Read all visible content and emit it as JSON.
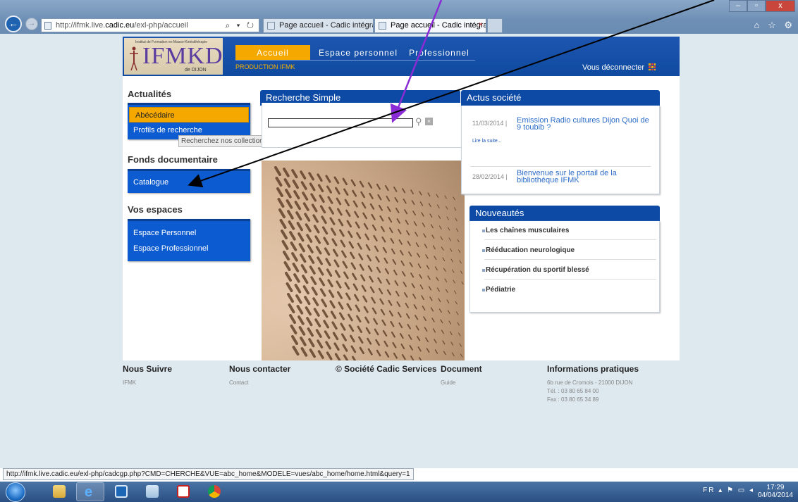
{
  "browser": {
    "url_prefix": "http://ifmk.live.",
    "url_domain": "cadic.eu",
    "url_suffix": "/exl-php/accueil",
    "address_tools": "⌕ ▾ ↻",
    "tabs": [
      {
        "label": "Page accueil - Cadic intégrale"
      },
      {
        "label": "Page accueil - Cadic intégrale",
        "close": "×"
      }
    ],
    "window_controls": {
      "minimize": "–",
      "maximize": "▫",
      "close": "x"
    },
    "right_icons": "⌂ ☆ ⚙"
  },
  "header": {
    "logo_small": "Institut de Formation en Masso-Kinésithérapie",
    "logo_text": "IFMKD",
    "logo_sub": "de DIJON",
    "nav": [
      {
        "label": "Accueil"
      },
      {
        "label": "Espace personnel"
      },
      {
        "label": "Professionnel"
      }
    ],
    "production": "PRODUCTION IFMK",
    "logout": "Vous déconnecter"
  },
  "left": {
    "actualites_title": "Actualités",
    "actualites_items": [
      {
        "label": "Abécédaire"
      },
      {
        "label": "Profils de recherche"
      }
    ],
    "fonds_title": "Fonds documentaire",
    "fonds_items": [
      {
        "label": "Catalogue"
      }
    ],
    "espaces_title": "Vos espaces",
    "espaces_items": [
      {
        "label": "Espace Personnel"
      },
      {
        "label": "Espace Professionnel"
      }
    ],
    "tooltip": "Recherchez nos collections de périodiques"
  },
  "search": {
    "title": "Recherche Simple",
    "value": "",
    "search_glyph": "⚲",
    "clear_glyph": "×"
  },
  "news": {
    "title": "Actus société",
    "items": [
      {
        "date": "11/03/2014 |",
        "title": "Emission Radio cultures Dijon Quoi de 9 toubib ?",
        "read_more": "Lire la suite..."
      },
      {
        "date": "28/02/2014 |",
        "title": "Bienvenue sur le portail de la bibliothèque IFMK"
      }
    ]
  },
  "new_arrivals": {
    "title": "Nouveautés",
    "items": [
      {
        "label": "Les chaînes musculaires"
      },
      {
        "label": "Rééducation neurologique"
      },
      {
        "label": "Récupération du sportif blessé"
      },
      {
        "label": "Pédiatrie"
      }
    ]
  },
  "footer": {
    "columns": [
      {
        "title": "Nous Suivre",
        "text": "IFMK"
      },
      {
        "title": "Nous contacter",
        "text": "Contact"
      },
      {
        "title": "© Société Cadic Services",
        "text": ""
      },
      {
        "title": "Document",
        "text": "Guide"
      },
      {
        "title": "Informations pratiques",
        "text": "6b rue de Cromois - 21000 DIJON\nTél. : 03 80 65 84 00\nFax : 03 80 65 34 89"
      }
    ]
  },
  "status_bar": {
    "url": "http://ifmk.live.cadic.eu/exl-php/cadcgp.php?CMD=CHERCHE&VUE=abc_home&MODELE=vues/abc_home/home.html&query=1"
  },
  "taskbar": {
    "tray": "FR  ▴  ⚑  ▭  ◂",
    "time": "17:29",
    "date": "04/04/2014"
  },
  "colors": {
    "header_blue": "#0f4aa0",
    "accent_orange": "#f5a900",
    "menu_blue": "#0d5bd0",
    "link_blue": "#2c6cc8"
  }
}
